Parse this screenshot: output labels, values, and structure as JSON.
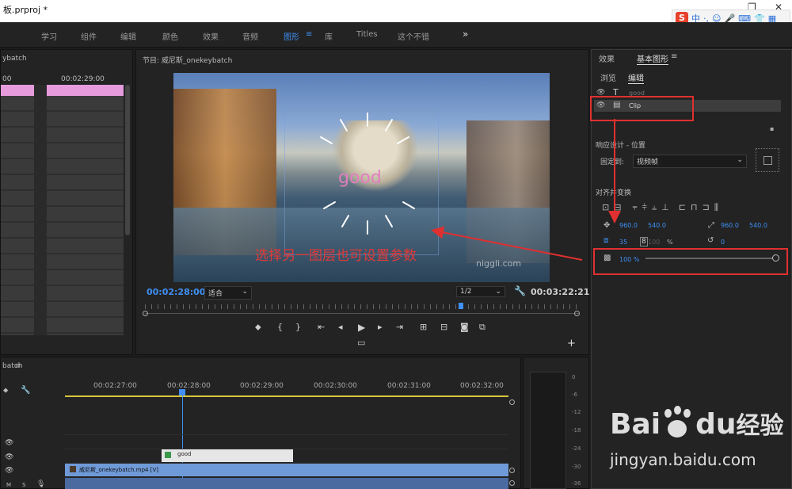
{
  "window": {
    "title": "板.prproj *",
    "restore_icon": "❐",
    "close_icon": "✕"
  },
  "ime": {
    "logo": "S",
    "mode": "中",
    "icons": [
      "·,",
      "☺",
      "🎤",
      "⌨",
      "👕",
      "👔",
      "▦"
    ]
  },
  "workspaces": [
    "学习",
    "组件",
    "编辑",
    "颜色",
    "效果",
    "音频",
    "图形",
    "库",
    "Titles",
    "这个不错"
  ],
  "workspace_active": "图形",
  "workspace_menu_icon": "≡",
  "workspace_more": "»",
  "left_panel": {
    "title": "ybatch",
    "timecode_a": "00",
    "timecode_b": "00:02:29:00"
  },
  "program": {
    "title": "节目: 威尼斯_onekeybatch",
    "menu_icon": "≡",
    "video_text": "good",
    "watermark": "niggli.com",
    "annotation": "选择另一图层也可设置参数",
    "current_time": "00:02:28:00",
    "fit_label": "适合",
    "resolution": "1/2",
    "duration": "00:03:22:21",
    "add_button": "+"
  },
  "essential_graphics": {
    "tabs": [
      "效果",
      "基本图形"
    ],
    "tab_menu_icon": "≡",
    "subtabs": [
      "浏览",
      "编辑"
    ],
    "layers": [
      {
        "name": "good",
        "type": "text"
      },
      {
        "name": "Clip",
        "type": "clip"
      }
    ],
    "responsive_title": "响应设计 - 位置",
    "pin_label": "固定到:",
    "pin_value": "视频帧",
    "align_title": "对齐并变换",
    "position_x": "960.0",
    "position_y": "540.0",
    "anchor_x": "960.0",
    "anchor_y": "540.0",
    "scale": "35",
    "scale_width_disabled": "100",
    "percent": "%",
    "rotation": "0",
    "opacity": "100 %",
    "opacity_value": 100
  },
  "timeline": {
    "title": "batch",
    "menu_icon": "≡",
    "ruler": [
      "00:02:27:00",
      "00:02:28:00",
      "00:02:29:00",
      "00:02:30:00",
      "00:02:31:00",
      "00:02:32:00"
    ],
    "text_clip": "good",
    "video_clip": "威尼斯_onekeybatch.mp4 [V]",
    "track_labels": [
      "M",
      "S"
    ]
  },
  "meter": {
    "scale": [
      "0",
      "-6",
      "-12",
      "-18",
      "-24",
      "-30",
      "-36"
    ]
  },
  "watermark_baidu": {
    "brand": "Bai",
    "brand2": "du",
    "cn": "经验",
    "url": "jingyan.baidu.com"
  }
}
